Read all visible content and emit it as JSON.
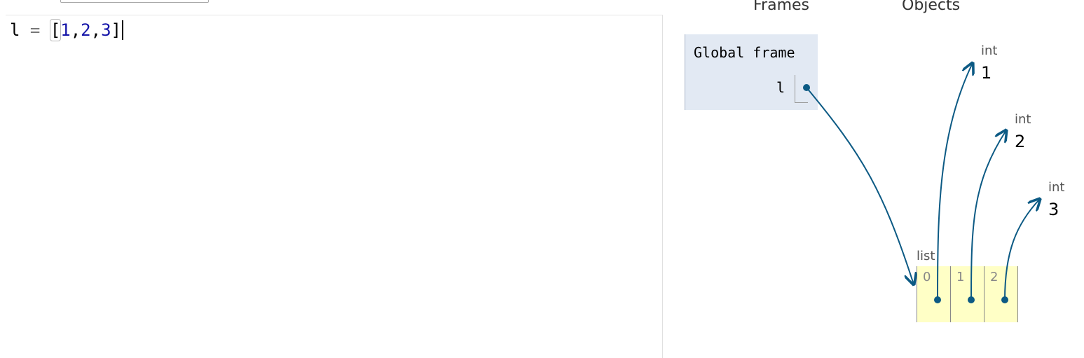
{
  "editor": {
    "tokens": {
      "var": "l",
      "eq": "=",
      "lbr": "[",
      "n1": "1",
      "c1": ",",
      "n2": "2",
      "c2": ",",
      "n3": "3",
      "rbr": "]"
    }
  },
  "visualizer": {
    "frames_label": "Frames",
    "objects_label": "Objects",
    "global_frame": {
      "title": "Global frame",
      "variable": "l"
    },
    "objects": {
      "ints": [
        {
          "type": "int",
          "value": "1"
        },
        {
          "type": "int",
          "value": "2"
        },
        {
          "type": "int",
          "value": "3"
        }
      ],
      "list": {
        "type": "list",
        "indices": [
          "0",
          "1",
          "2"
        ]
      }
    },
    "colors": {
      "arrow": "#0c5a84",
      "frame_bg": "#e2e9f3",
      "list_bg": "#ffffc6"
    }
  }
}
